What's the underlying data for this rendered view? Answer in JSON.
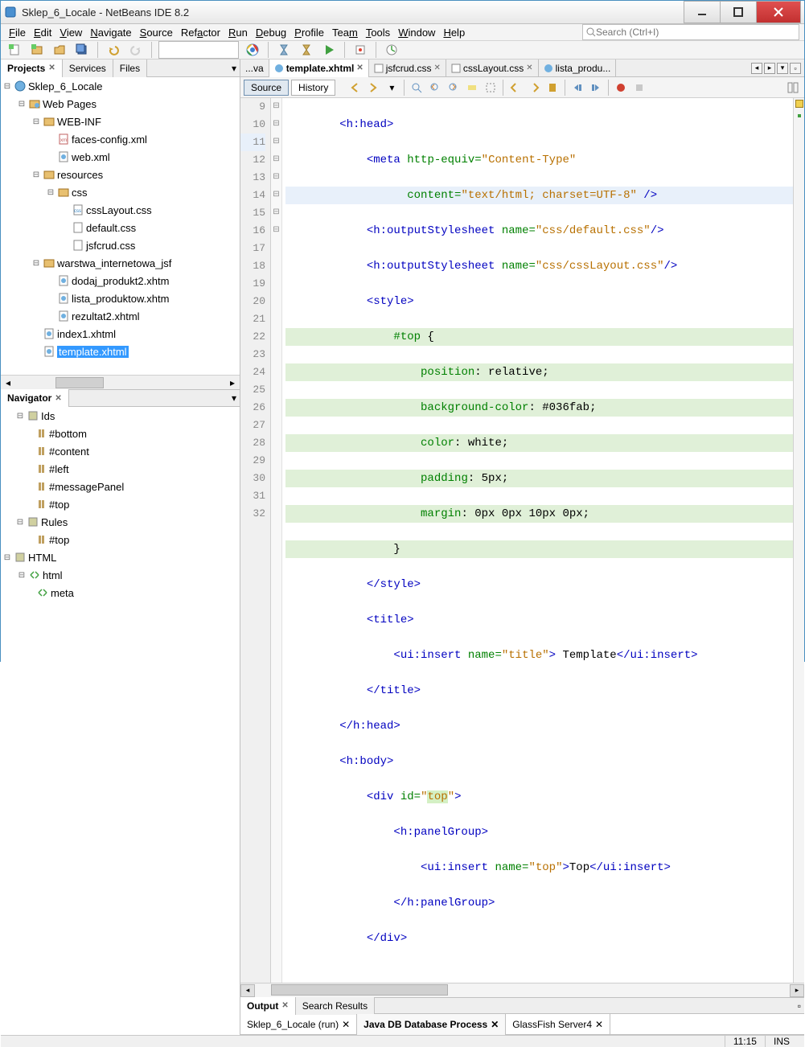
{
  "window": {
    "title": "Sklep_6_Locale - NetBeans IDE 8.2"
  },
  "menu": [
    "File",
    "Edit",
    "View",
    "Navigate",
    "Source",
    "Refactor",
    "Run",
    "Debug",
    "Profile",
    "Team",
    "Tools",
    "Window",
    "Help"
  ],
  "search": {
    "placeholder": "Search (Ctrl+I)"
  },
  "projects_panel": {
    "tabs": [
      "Projects",
      "Services",
      "Files"
    ],
    "tree": {
      "root": "Sklep_6_Locale",
      "web_pages": "Web Pages",
      "web_inf": "WEB-INF",
      "faces_config": "faces-config.xml",
      "web_xml": "web.xml",
      "resources": "resources",
      "css": "css",
      "cssLayout": "cssLayout.css",
      "default_css": "default.css",
      "jsfcrud": "jsfcrud.css",
      "warstwa": "warstwa_internetowa_jsf",
      "dodaj": "dodaj_produkt2.xhtm",
      "lista": "lista_produktow.xhtm",
      "rezultat": "rezultat2.xhtml",
      "index1": "index1.xhtml",
      "template": "template.xhtml"
    }
  },
  "navigator_panel": {
    "tab": "Navigator",
    "ids_label": "Ids",
    "ids": [
      "#bottom",
      "#content",
      "#left",
      "#messagePanel",
      "#top"
    ],
    "rules_label": "Rules",
    "rules": [
      "#top"
    ],
    "html_label": "HTML",
    "html_root": "html",
    "html_child": "meta"
  },
  "editor": {
    "tabs": [
      "...va",
      "template.xhtml",
      "jsfcrud.css",
      "cssLayout.css",
      "lista_produ..."
    ],
    "active_tab": 1,
    "modes": [
      "Source",
      "History"
    ],
    "lines": {
      "start": 9,
      "end": 32
    }
  },
  "code": {
    "l9a": "<h:head>",
    "l10a": "<meta ",
    "l10b": "http-equiv=",
    "l10c": "\"Content-Type\"",
    "l11a": "content=",
    "l11b": "\"text/html; charset=UTF-8\"",
    "l11c": " />",
    "l12a": "<h:outputStylesheet ",
    "l12b": "name=",
    "l12c": "\"css/default.css\"",
    "l12d": "/>",
    "l13a": "<h:outputStylesheet ",
    "l13b": "name=",
    "l13c": "\"css/cssLayout.css\"",
    "l13d": "/>",
    "l14a": "<style>",
    "l15a": "#top",
    "l15b": " {",
    "l16a": "position",
    "l16b": ": relative;",
    "l17a": "background-color",
    "l17b": ": #036fab;",
    "l18a": "color",
    "l18b": ": white;",
    "l19a": "padding",
    "l19b": ": 5px;",
    "l20a": "margin",
    "l20b": ": 0px 0px 10px 0px;",
    "l21a": "}",
    "l22a": "</style>",
    "l23a": "<title>",
    "l24a": "<ui:insert ",
    "l24b": "name=",
    "l24c": "\"title\"",
    "l24d": "> Template",
    "l24e": "</ui:insert>",
    "l25a": "</title>",
    "l26a": "</h:head>",
    "l27a": "<h:body>",
    "l28a": "<div ",
    "l28b": "id=",
    "l28c": "\"",
    "l28d": "top",
    "l28e": "\"",
    "l28f": ">",
    "l29a": "<h:panelGroup>",
    "l30a": "<ui:insert ",
    "l30b": "name=",
    "l30c": "\"top\"",
    "l30d": ">Top",
    "l30e": "</ui:insert>",
    "l31a": "</h:panelGroup>",
    "l32a": "</div>"
  },
  "output": {
    "tabs": [
      "Output",
      "Search Results"
    ],
    "run_tabs": [
      "Sklep_6_Locale (run)",
      "Java DB Database Process",
      "GlassFish Server4"
    ]
  },
  "status": {
    "pos": "11:15",
    "mode": "INS"
  }
}
